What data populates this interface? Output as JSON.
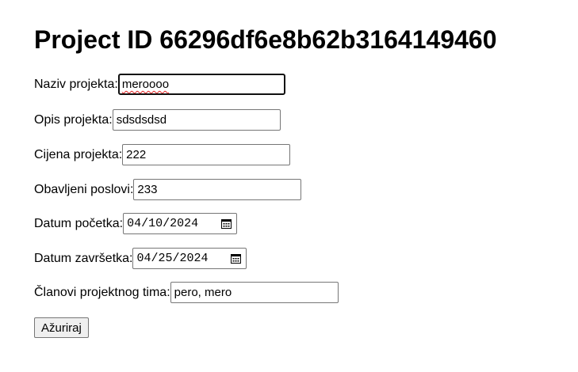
{
  "page": {
    "title": "Project ID 66296df6e8b62b3164149460"
  },
  "form": {
    "naziv": {
      "label": "Naziv projekta:",
      "value": "meroooo"
    },
    "opis": {
      "label": "Opis projekta:",
      "value": "sdsdsdsd"
    },
    "cijena": {
      "label": "Cijena projekta:",
      "value": "222"
    },
    "poslovi": {
      "label": "Obavljeni poslovi:",
      "value": "233"
    },
    "pocetak": {
      "label": "Datum početka:",
      "value": "04/10/2024"
    },
    "zavrsetak": {
      "label": "Datum završetka:",
      "value": "04/25/2024"
    },
    "clanovi": {
      "label": "Članovi projektnog tima:",
      "value": "pero, mero"
    },
    "submit_label": "Ažuriraj"
  }
}
